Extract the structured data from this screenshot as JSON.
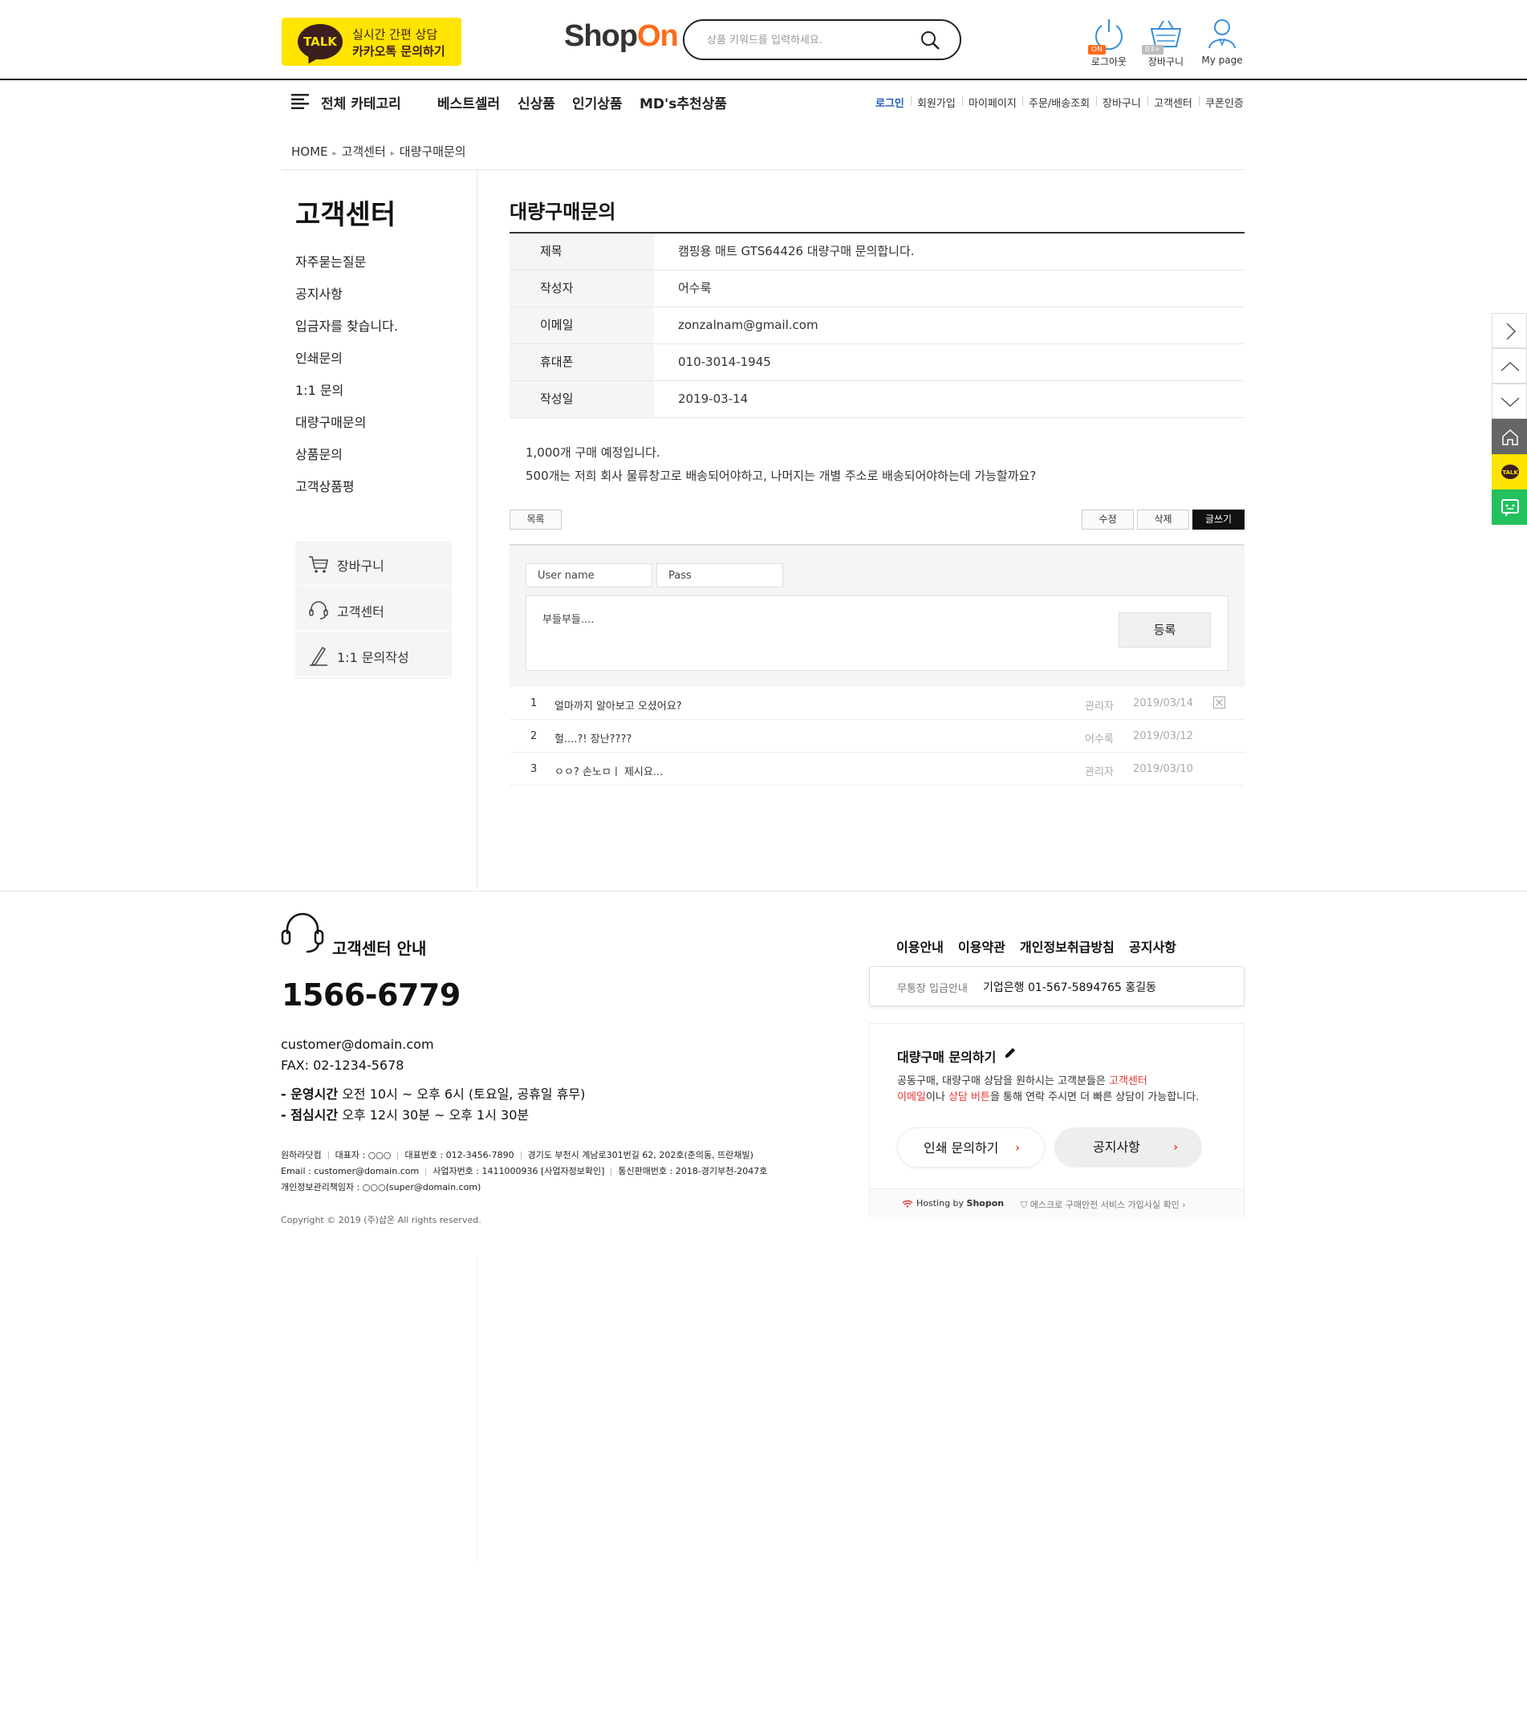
{
  "header": {
    "kakao_line1": "실시간 간편 상담",
    "kakao_line2": "카카오톡 문의하기",
    "kakao_talk": "TALK",
    "logo_shop": "Shop",
    "logo_on": "On",
    "search_placeholder": "상품 키워드를 입력하세요.",
    "icons": [
      {
        "label": "로그아웃",
        "badge": "ON",
        "icon": "power-icon"
      },
      {
        "label": "장바구니",
        "badge": "03+",
        "icon": "cart-icon"
      },
      {
        "label": "My page",
        "icon": "user-icon"
      }
    ]
  },
  "nav": {
    "category": "전체 카테고리",
    "main": [
      "베스트셀러",
      "신상품",
      "인기상품",
      "MD's추천상품"
    ],
    "util": [
      "로그인",
      "회원가입",
      "마이페이지",
      "주문/배송조회",
      "장바구니",
      "고객센터",
      "쿠폰인증"
    ]
  },
  "breadcrumb": [
    "HOME",
    "고객센터",
    "대량구매문의"
  ],
  "sidebar": {
    "title": "고객센터",
    "menu": [
      "자주묻는질문",
      "공지사항",
      "입금자를 찾습니다.",
      "인쇄문의",
      "1:1 문의",
      "대량구매문의",
      "상품문의",
      "고객상품평"
    ],
    "box": [
      {
        "label": "장바구니",
        "icon": "cart-icon"
      },
      {
        "label": "고객센터",
        "icon": "headset-icon"
      },
      {
        "label": "1:1 문의작성",
        "icon": "pencil-icon"
      }
    ]
  },
  "content": {
    "title": "대량구매문의",
    "rows": [
      {
        "label": "제목",
        "value": "캠핑용 매트 GTS64426 대량구매 문의합니다."
      },
      {
        "label": "작성자",
        "value": "어수룩"
      },
      {
        "label": "이메일",
        "value": "zonzalnam@gmail.com"
      },
      {
        "label": "휴대폰",
        "value": "010-3014-1945"
      },
      {
        "label": "작성일",
        "value": "2019-03-14"
      }
    ],
    "body_line1": "1,000개 구매 예정입니다.",
    "body_line2": "500개는 저희 회사 물류창고로 배송되어야하고, 나머지는 개별 주소로 배송되어야하는데 가능할까요?",
    "buttons": {
      "list": "목록",
      "edit": "수정",
      "delete": "삭제",
      "write": "글쓰기"
    },
    "comment_form": {
      "user_placeholder": "User name",
      "pass_placeholder": "Pass",
      "text": "부들부들....",
      "submit": "등록"
    },
    "comments": [
      {
        "num": "1",
        "body": "얼마까지 알아보고 오셨어요?",
        "author": "관리자",
        "date": "2019/03/14"
      },
      {
        "num": "2",
        "body": "헐....?! 장난????",
        "author": "어수룩",
        "date": "2019/03/12"
      },
      {
        "num": "3",
        "body": "ㅇㅇ? 손노ㅁㅣ 제시요...",
        "author": "관리자",
        "date": "2019/03/10"
      }
    ]
  },
  "footer": {
    "cs_title": "고객센터 안내",
    "phone": "1566-6779",
    "email": "customer@domain.com",
    "fax": "FAX: 02-1234-5678",
    "hours_label": "- 운영시간",
    "hours": "오전 10시 ~ 오후 6시 (토요일, 공휴일 휴무)",
    "lunch_label": "- 점심시간",
    "lunch": "오후 12시 30분 ~ 오후 1시 30분",
    "company": {
      "name": "원하라닷컴",
      "ceo": "대표자 : ○○○",
      "tel": "대표번호 : 012-3456-7890",
      "address": "경기도 부천시 계남로301번길 62, 202호(춘의동, 뜨란채빌)",
      "email": "Email : customer@domain.com",
      "bizno": "사업자번호 : 1411000936 [사업자정보확인]",
      "mailorder": "통신판매번호 : 2018-경기부천-2047호",
      "privacy": "개인정보관리책임자 : ○○○(super@domain.com)"
    },
    "copyright": "Copyright © 2019 (주)샵온 All rights reserved.",
    "links": [
      "이용안내",
      "이용약관",
      "개인정보취급방침",
      "공지사항"
    ],
    "bank_label": "무통장 입금안내",
    "bank_value": "기업은행 01-567-5894765   홍길동",
    "bulk_title": "대량구매 문의하기",
    "bulk_desc_1": "공동구매, 대량구매 상담을 원하시는 고객분들은 ",
    "bulk_desc_red1": "고객센터",
    "bulk_desc_red2": "이메일",
    "bulk_desc_2": "이나 ",
    "bulk_desc_red3": "상담 버튼",
    "bulk_desc_3": "을 통해 연락 주시면 더 빠른 상담이 가능합니다.",
    "btn_print": "인쇄 문의하기",
    "btn_notice": "공지사항",
    "hosting_prefix": "Hosting by ",
    "hosting_name": "Shopon",
    "escrow": "에스크로 구매안전 서비스 가입사실 확인 ›"
  },
  "float_bar": [
    "next-icon",
    "scroll-up-icon",
    "scroll-down-icon",
    "home-icon",
    "kakao-talk-icon",
    "chat-icon"
  ]
}
